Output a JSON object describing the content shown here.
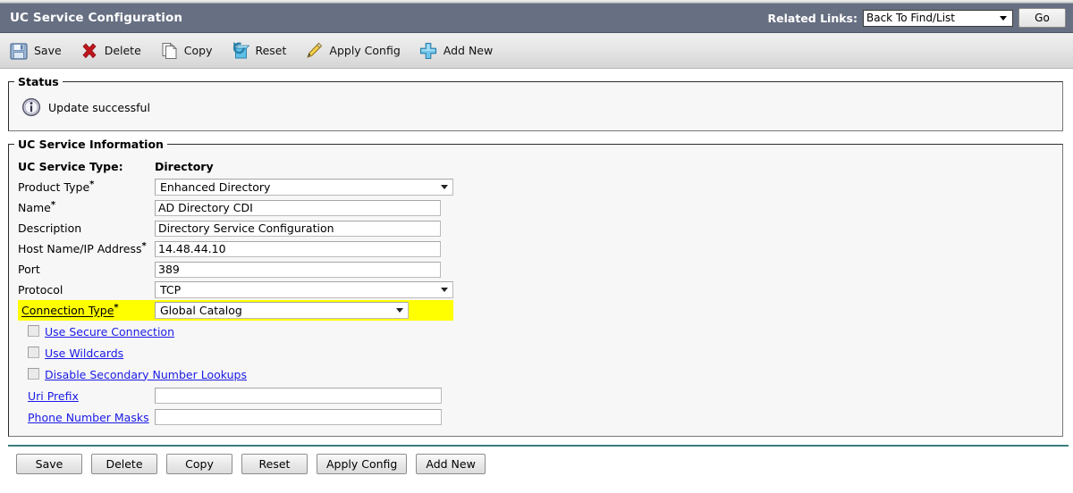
{
  "header": {
    "title": "UC Service Configuration",
    "related_links_label": "Related Links:",
    "related_links_value": "Back To Find/List",
    "go_label": "Go"
  },
  "toolbar": {
    "items": [
      {
        "label": "Save",
        "icon": "save-icon"
      },
      {
        "label": "Delete",
        "icon": "delete-icon"
      },
      {
        "label": "Copy",
        "icon": "copy-icon"
      },
      {
        "label": "Reset",
        "icon": "reset-icon"
      },
      {
        "label": "Apply Config",
        "icon": "apply-config-icon"
      },
      {
        "label": "Add New",
        "icon": "add-new-icon"
      }
    ]
  },
  "status": {
    "legend": "Status",
    "icon": "info-icon",
    "message": "Update successful"
  },
  "service_info": {
    "legend": "UC Service Information",
    "service_type_label": "UC Service Type:",
    "service_type_value": "Directory",
    "fields": [
      {
        "label": "Product Type",
        "required": true,
        "type": "select",
        "value": "Enhanced Directory",
        "name": "product-type"
      },
      {
        "label": "Name",
        "required": true,
        "type": "text",
        "value": "AD Directory CDI",
        "name": "name"
      },
      {
        "label": "Description",
        "required": false,
        "type": "text",
        "value": "Directory Service Configuration",
        "name": "description"
      },
      {
        "label": "Host Name/IP Address",
        "required": true,
        "type": "text",
        "value": "14.48.44.10",
        "name": "host-name-ip-address"
      },
      {
        "label": "Port",
        "required": false,
        "type": "text",
        "value": "389",
        "name": "port"
      },
      {
        "label": "Protocol",
        "required": false,
        "type": "select",
        "value": "TCP",
        "name": "protocol"
      }
    ],
    "connection_type": {
      "label": "Connection Type",
      "required": true,
      "value": "Global Catalog",
      "highlight_color": "#ffff00"
    },
    "checkboxes": [
      {
        "label": "Use Secure Connection",
        "checked": false,
        "name": "use-secure-connection"
      },
      {
        "label": "Use Wildcards",
        "checked": false,
        "name": "use-wildcards"
      },
      {
        "label": "Disable Secondary Number Lookups",
        "checked": false,
        "name": "disable-secondary-number-lookups"
      }
    ],
    "extra_fields": [
      {
        "label": "Uri Prefix",
        "value": "",
        "placeholder": "",
        "name": "uri-prefix"
      },
      {
        "label": "Phone Number Masks",
        "value": "",
        "placeholder": "",
        "name": "phone-number-masks"
      }
    ]
  },
  "footer": {
    "buttons": [
      "Save",
      "Delete",
      "Copy",
      "Reset",
      "Apply Config",
      "Add New"
    ]
  },
  "colors": {
    "header_bar": "#676f82",
    "link": "#1a1ae6",
    "highlight": "#ffff00",
    "rule": "#3d7d7d"
  }
}
